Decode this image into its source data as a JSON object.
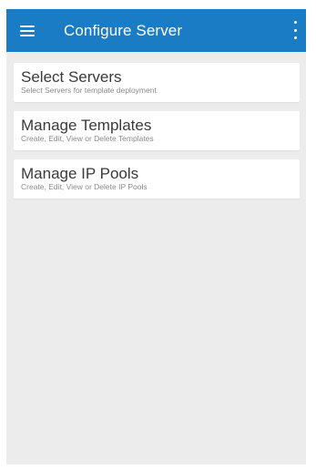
{
  "appbar": {
    "title": "Configure Server",
    "menu_icon": "hamburger-menu-icon",
    "overflow_icon": "more-vert-icon",
    "color": "#1a7cc4"
  },
  "items": [
    {
      "title": "Select Servers",
      "subtitle": "Select Servers for template deployment"
    },
    {
      "title": "Manage Templates",
      "subtitle": "Create, Edit, View or Delete Templates"
    },
    {
      "title": "Manage IP Pools",
      "subtitle": "Create, Edit, View or Delete IP Pools"
    }
  ]
}
